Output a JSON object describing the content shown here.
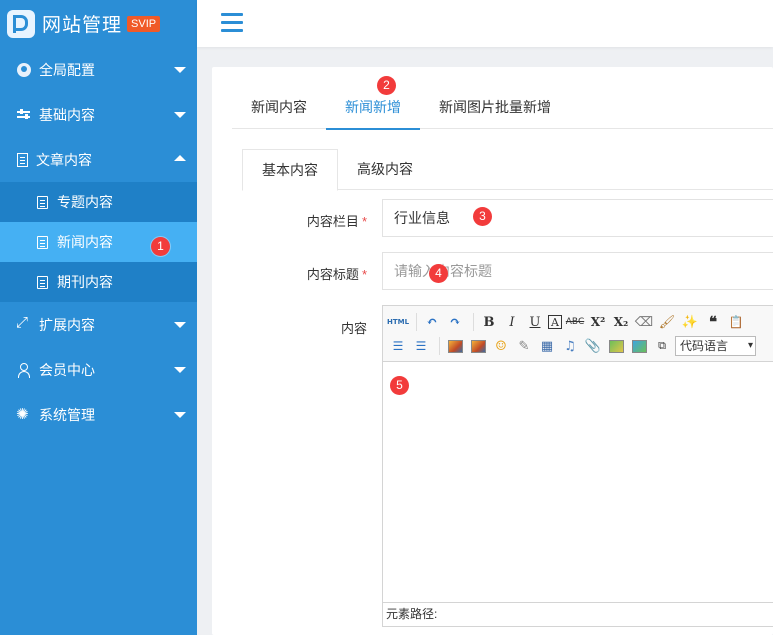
{
  "brand": {
    "title": "网站管理",
    "badge": "SVIP"
  },
  "sidebar": {
    "items": [
      {
        "label": "全局配置"
      },
      {
        "label": "基础内容"
      },
      {
        "label": "文章内容"
      },
      {
        "label": "扩展内容"
      },
      {
        "label": "会员中心"
      },
      {
        "label": "系统管理"
      }
    ],
    "article_sub": [
      {
        "label": "专题内容"
      },
      {
        "label": "新闻内容"
      },
      {
        "label": "期刊内容"
      }
    ]
  },
  "top_tabs": [
    {
      "label": "新闻内容"
    },
    {
      "label": "新闻新增"
    },
    {
      "label": "新闻图片批量新增"
    }
  ],
  "sub_tabs": [
    {
      "label": "基本内容"
    },
    {
      "label": "高级内容"
    }
  ],
  "form": {
    "column_label": "内容栏目",
    "column_value": "行业信息",
    "title_label": "内容标题",
    "title_placeholder": "请输入内容标题",
    "content_label": "内容",
    "required_mark": "*"
  },
  "editor": {
    "html_label": "HTML",
    "code_lang": "代码语言",
    "footer_path": "元素路径:"
  },
  "markers": [
    "1",
    "2",
    "3",
    "4",
    "5"
  ]
}
